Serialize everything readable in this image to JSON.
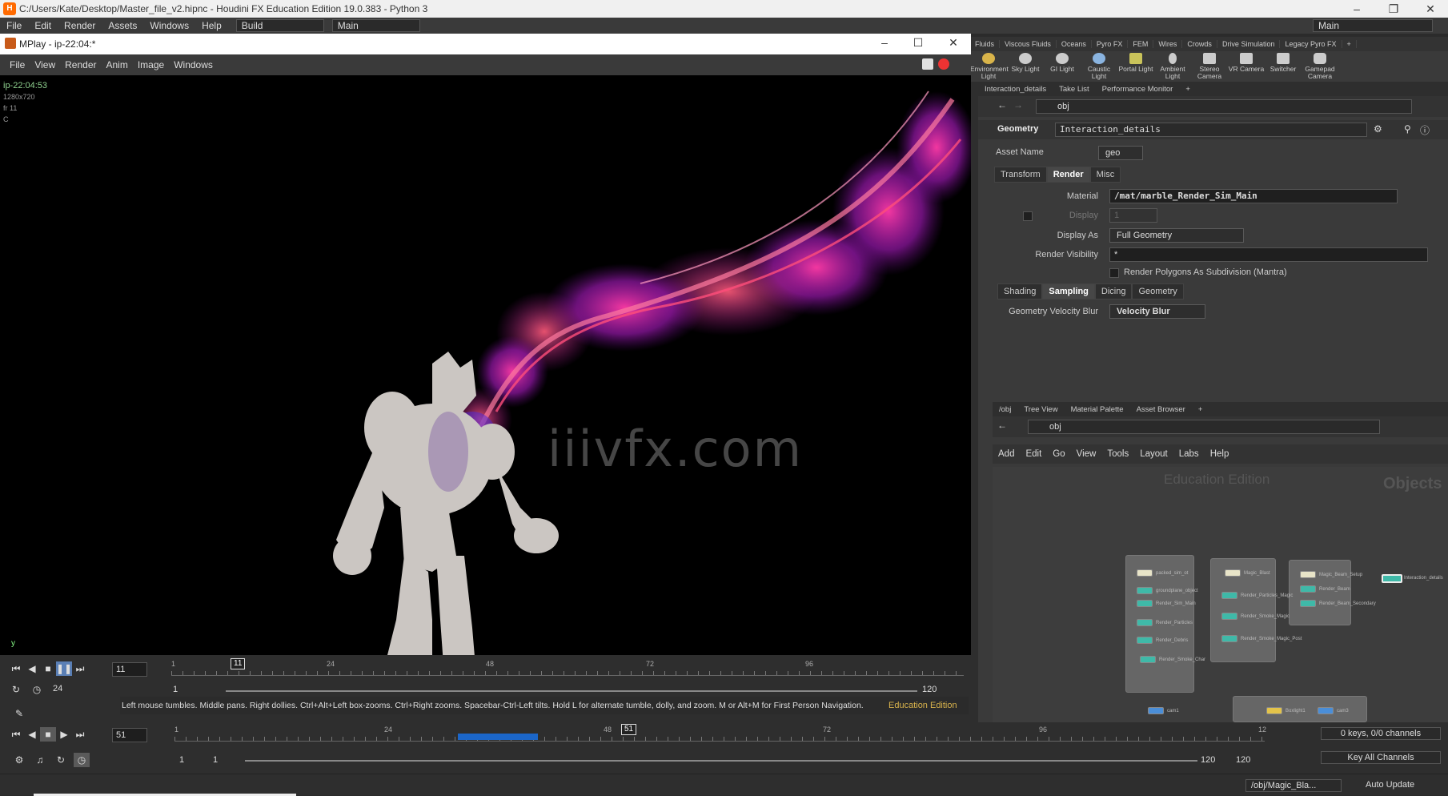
{
  "houdini": {
    "title": "C:/Users/Kate/Desktop/Master_file_v2.hipnc - Houdini FX Education Edition 19.0.383 - Python 3",
    "menu": [
      "File",
      "Edit",
      "Render",
      "Assets",
      "Windows",
      "Help"
    ],
    "desktop": "Build",
    "context": "Main",
    "desktop_right": "Main"
  },
  "shelf": {
    "tabs": [
      "Fluids",
      "Viscous Fluids",
      "Oceans",
      "Pyro FX",
      "FEM",
      "Wires",
      "Crowds",
      "Drive Simulation",
      "Legacy Pyro FX"
    ],
    "tools": [
      "Environment Light",
      "Sky Light",
      "GI Light",
      "Caustic Light",
      "Portal Light",
      "Ambient Light",
      "Stereo Camera",
      "VR Camera",
      "Switcher",
      "Gamepad Camera"
    ]
  },
  "mplay": {
    "title": "MPlay - ip-22:04:*",
    "menu": [
      "File",
      "View",
      "Render",
      "Anim",
      "Image",
      "Windows"
    ],
    "info": {
      "name": "ip-22:04:53",
      "res": "1280x720",
      "frame": "fr 11",
      "chan": "C"
    },
    "watermark": "iiivfx.com",
    "timeline": {
      "current_frame": "11",
      "fps": "24",
      "start": "1",
      "end": "120",
      "ticks": [
        "1",
        "24",
        "48",
        "72",
        "96"
      ],
      "marker": "11"
    }
  },
  "hint": "Left mouse tumbles. Middle pans. Right dollies. Ctrl+Alt+Left box-zooms. Ctrl+Right zooms. Spacebar-Ctrl-Left tilts. Hold L for alternate tumble, dolly, and zoom.    M or Alt+M for First Person Navigation.",
  "edu_badge": "Education Edition",
  "params": {
    "tabs": [
      "Interaction_details",
      "Take List",
      "Performance Monitor"
    ],
    "path": "obj",
    "node_type": "Geometry",
    "node_name": "Interaction_details",
    "asset_name_label": "Asset Name",
    "asset_name_value": "geo",
    "main_tabs": [
      "Transform",
      "Render",
      "Misc"
    ],
    "material_label": "Material",
    "material_value": "/mat/marble_Render_Sim_Main",
    "display_label": "Display",
    "display_value": "1",
    "display_as_label": "Display As",
    "display_as_value": "Full Geometry",
    "render_vis_label": "Render Visibility",
    "render_vis_value": "*",
    "subdiv_label": "Render Polygons As Subdivision (Mantra)",
    "sub_tabs": [
      "Shading",
      "Sampling",
      "Dicing",
      "Geometry"
    ],
    "velblur_label": "Geometry Velocity Blur",
    "velblur_value": "Velocity Blur"
  },
  "network": {
    "tabs": [
      "/obj",
      "Tree View",
      "Material Palette",
      "Asset Browser"
    ],
    "path": "obj",
    "menu": [
      "Add",
      "Edit",
      "Go",
      "View",
      "Tools",
      "Layout",
      "Labs",
      "Help"
    ],
    "edu_watermark": "Education Edition",
    "objects_label": "Objects",
    "nodes_a": [
      "packed_sim_ot",
      "groundplane_object",
      "Render_Sim_Main",
      "Render_Particles",
      "Render_Debris",
      "Render_Smoke_Char"
    ],
    "nodes_b": [
      "Magic_Blast",
      "Render_Particles_Magic",
      "Render_Smoke_Magic",
      "Render_Smoke_Magic_Post"
    ],
    "nodes_c": [
      "Magic_Beam_Setup",
      "Render_Beam",
      "Render_Beam_Secondary"
    ],
    "node_d": "Interaction_details",
    "bottom_nodes": [
      "cam1",
      "Boxlight1",
      "cam3"
    ]
  },
  "main_timeline": {
    "current_frame": "51",
    "start": "1",
    "start2": "1",
    "end": "120",
    "end2": "120",
    "ticks": [
      "1",
      "24",
      "48",
      "72",
      "96",
      "12"
    ],
    "marker": "51",
    "keys": "0 keys, 0/0 channels",
    "key_all": "Key All Channels"
  },
  "status": {
    "path": "/obj/Magic_Bla...",
    "auto_update": "Auto Update"
  }
}
